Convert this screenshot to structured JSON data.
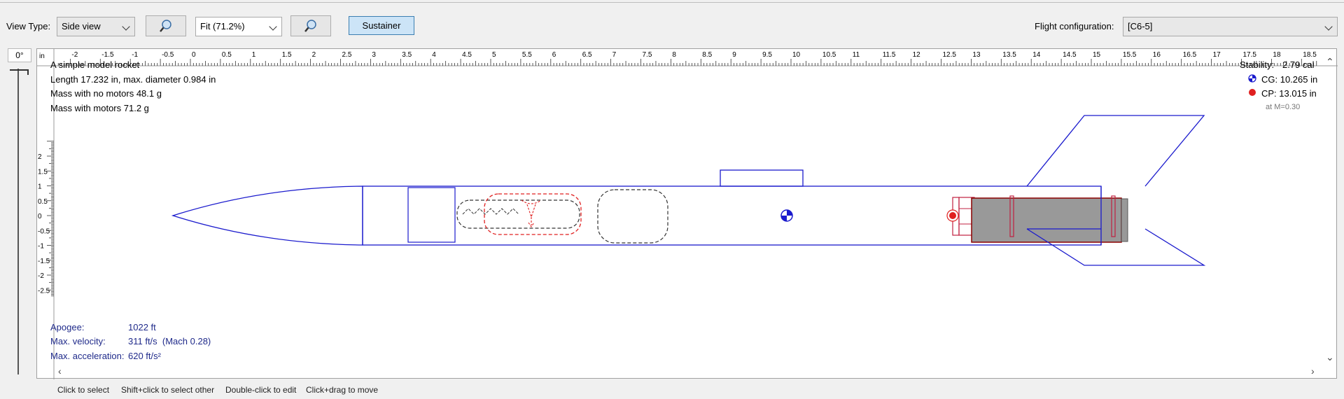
{
  "toolbar": {
    "view_type_label": "View Type:",
    "view_type_value": "Side view",
    "zoom_value": "Fit (71.2%)",
    "stage_button": "Sustainer",
    "flight_config_label": "Flight configuration:",
    "flight_config_value": "[C6-5]"
  },
  "rotation": {
    "angle": "0°"
  },
  "ruler": {
    "unit": "in",
    "ticks": [
      "-2",
      "-1.5",
      "-1",
      "-0.5",
      "0",
      "0.5",
      "1",
      "1.5",
      "2",
      "2.5",
      "3",
      "3.5",
      "4",
      "4.5",
      "5",
      "5.5",
      "6",
      "6.5",
      "7",
      "7.5",
      "8",
      "8.5",
      "9",
      "9.5",
      "10",
      "10.5",
      "11",
      "11.5",
      "12",
      "12.5",
      "13",
      "13.5",
      "14",
      "14.5",
      "15",
      "15.5",
      "16",
      "16.5",
      "17",
      "17.5",
      "18",
      "18.5"
    ],
    "vticks": [
      "2",
      "1.5",
      "1",
      "0.5",
      "0",
      "-0.5",
      "-1",
      "-1.5",
      "-2",
      "-2.5"
    ]
  },
  "rocket_info": {
    "name": "A simple model rocket",
    "length": "Length 17.232 in, max. diameter 0.984 in",
    "mass_no_motors": "Mass with no motors 48.1 g",
    "mass_with_motors": "Mass with motors 71.2 g"
  },
  "stability": {
    "label": "Stability:",
    "value": "2.79 cal",
    "cg": "CG: 10.265 in",
    "cp": "CP: 13.015 in",
    "mach": "at M=0.30"
  },
  "flight": {
    "apogee_label": "Apogee:",
    "apogee_value": "1022 ft",
    "velocity_label": "Max. velocity:",
    "velocity_value": "311 ft/s  (Mach 0.28)",
    "accel_label": "Max. acceleration:",
    "accel_value": "620 ft/s²"
  },
  "hints": [
    "Click to select",
    "Shift+click to select other",
    "Double-click to edit",
    "Click+drag to move"
  ],
  "colors": {
    "body": "#1a1acd",
    "recovery": "#e02020",
    "motor": "#999999",
    "motor_outline": "#8b0000",
    "selected": "#cce4f7"
  }
}
